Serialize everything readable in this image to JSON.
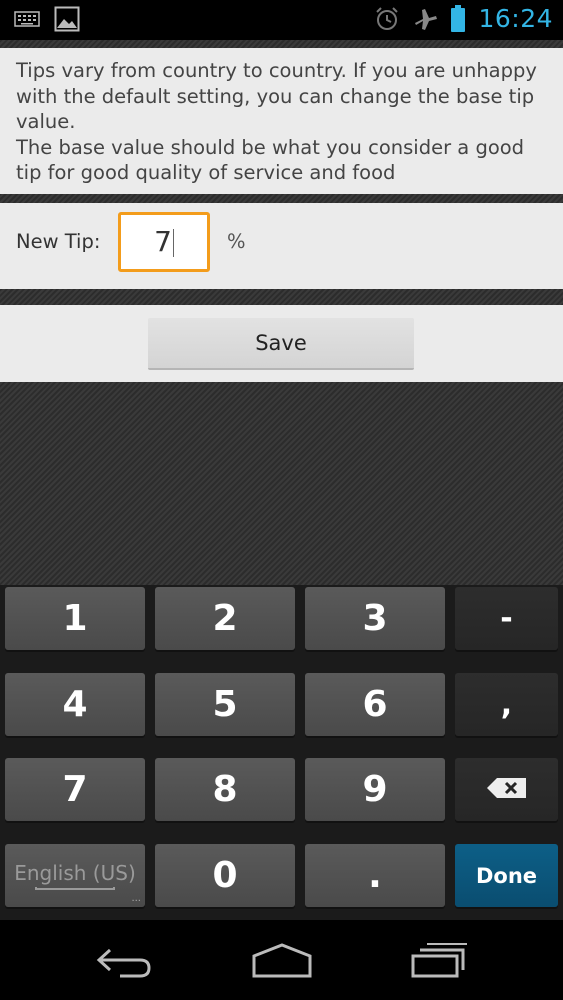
{
  "statusbar": {
    "time": "16:24",
    "icons": [
      "keyboard-icon",
      "image-icon",
      "alarm-icon",
      "airplane-icon",
      "battery-icon"
    ],
    "accent_color": "#33b5e5"
  },
  "info": {
    "line1": "Tips vary from country to country. If you are unhappy with the default setting, you can change the base tip value.",
    "line2": "The base value should be what you consider a good tip for good quality of service and food"
  },
  "tip": {
    "label": "New Tip:",
    "value": "7",
    "unit": "%",
    "focus_color": "#f39c1b"
  },
  "save": {
    "label": "Save"
  },
  "keyboard": {
    "keys": [
      "1",
      "2",
      "3",
      "-",
      "4",
      "5",
      "6",
      ",",
      "7",
      "8",
      "9",
      "0",
      "."
    ],
    "lang_label": "English (US)",
    "lang_dots": "...",
    "done_label": "Done",
    "backspace_icon": "backspace-icon",
    "done_color": "#0a4d70"
  },
  "navbar": {
    "icons": [
      "back-icon",
      "home-icon",
      "recent-apps-icon"
    ]
  }
}
